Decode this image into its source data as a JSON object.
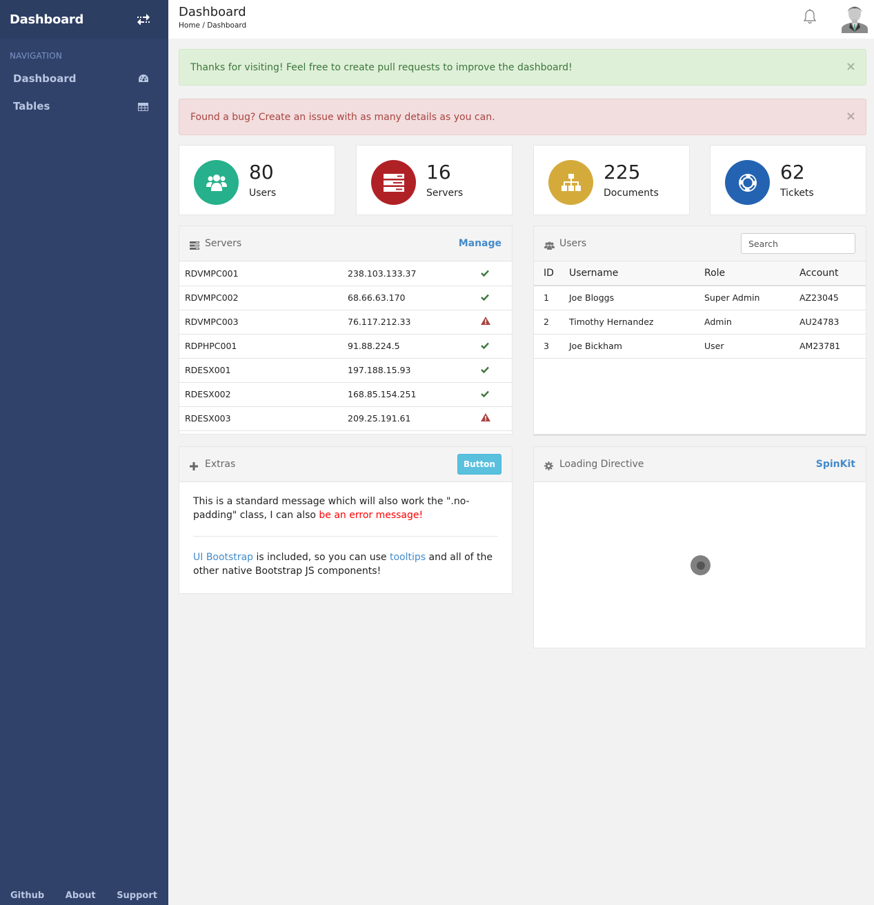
{
  "sidebar": {
    "brand": "Dashboard",
    "toggle_icon": "exchange-icon",
    "nav_title": "NAVIGATION",
    "items": [
      {
        "label": "Dashboard",
        "icon": "dashboard-gauge-icon"
      },
      {
        "label": "Tables",
        "icon": "table-icon"
      }
    ],
    "footer": [
      {
        "label": "Github"
      },
      {
        "label": "About"
      },
      {
        "label": "Support"
      }
    ]
  },
  "header": {
    "title": "Dashboard",
    "breadcrumb": "Home / Dashboard",
    "bell_icon": "bell-icon",
    "avatar": "user-avatar"
  },
  "alerts": [
    {
      "type": "success",
      "text": "Thanks for visiting! Feel free to create pull requests to improve the dashboard!",
      "close": "×"
    },
    {
      "type": "danger",
      "text": "Found a bug? Create an issue with as many details as you can.",
      "close": "×"
    }
  ],
  "stats": [
    {
      "value": "80",
      "label": "Users",
      "icon": "users-icon",
      "color": "#26b08b"
    },
    {
      "value": "16",
      "label": "Servers",
      "icon": "server-icon",
      "color": "#b02126"
    },
    {
      "value": "225",
      "label": "Documents",
      "icon": "sitemap-icon",
      "color": "#d4ab3a"
    },
    {
      "value": "62",
      "label": "Tickets",
      "icon": "life-ring-icon",
      "color": "#2463b1"
    }
  ],
  "servers_widget": {
    "title": "Servers",
    "link": "Manage",
    "rows": [
      {
        "name": "RDVMPC001",
        "ip": "238.103.133.37",
        "status": "ok"
      },
      {
        "name": "RDVMPC002",
        "ip": "68.66.63.170",
        "status": "ok"
      },
      {
        "name": "RDVMPC003",
        "ip": "76.117.212.33",
        "status": "warning"
      },
      {
        "name": "RDPHPC001",
        "ip": "91.88.224.5",
        "status": "ok"
      },
      {
        "name": "RDESX001",
        "ip": "197.188.15.93",
        "status": "ok"
      },
      {
        "name": "RDESX002",
        "ip": "168.85.154.251",
        "status": "ok"
      },
      {
        "name": "RDESX003",
        "ip": "209.25.191.61",
        "status": "warning"
      }
    ],
    "status_colors": {
      "ok": "#3c763d",
      "warning": "#a94442"
    }
  },
  "users_widget": {
    "title": "Users",
    "search_placeholder": "Search",
    "columns": [
      "ID",
      "Username",
      "Role",
      "Account"
    ],
    "rows": [
      {
        "id": "1",
        "username": "Joe Bloggs",
        "role": "Super Admin",
        "account": "AZ23045"
      },
      {
        "id": "2",
        "username": "Timothy Hernandez",
        "role": "Admin",
        "account": "AU24783"
      },
      {
        "id": "3",
        "username": "Joe Bickham",
        "role": "User",
        "account": "AM23781"
      }
    ]
  },
  "extras_widget": {
    "title": "Extras",
    "button": "Button",
    "p1_text": "This is a standard message which will also work the \".no-padding\" class, I can also ",
    "p1_error": "be an error message!",
    "p2_link1": "UI Bootstrap",
    "p2_mid": " is included, so you can use ",
    "p2_link2": "tooltips",
    "p2_end": " and all of the other native Bootstrap JS components!"
  },
  "loading_widget": {
    "title": "Loading Directive",
    "link": "SpinKit"
  }
}
